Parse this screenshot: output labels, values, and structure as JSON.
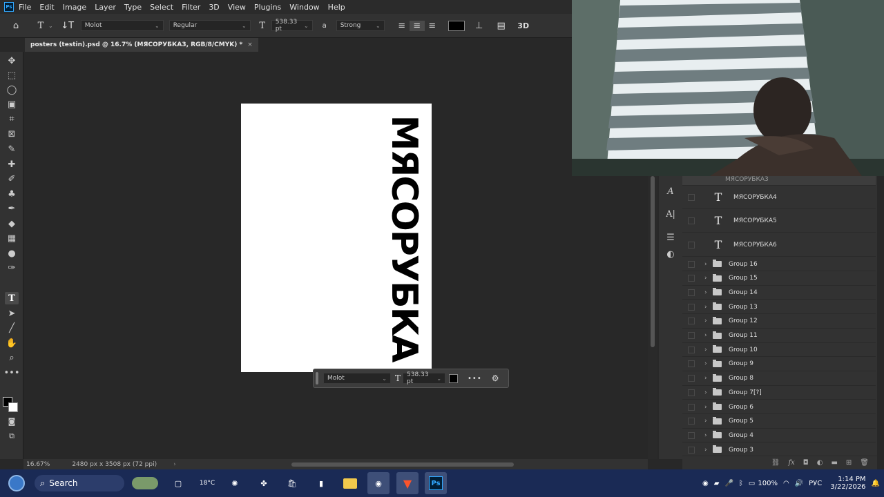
{
  "menubar": {
    "logo": "Ps",
    "items": [
      "File",
      "Edit",
      "Image",
      "Layer",
      "Type",
      "Select",
      "Filter",
      "3D",
      "View",
      "Plugins",
      "Window",
      "Help"
    ]
  },
  "options": {
    "font_family": "Molot",
    "font_style": "Regular",
    "font_size": "538.33 pt",
    "antialias_icon_label": "a",
    "antialias": "Strong",
    "threed_label": "3D",
    "text_color": "#000000"
  },
  "document": {
    "tab_title": "posters (testin).psd @ 16.7% (МЯСОРУБКА3, RGB/8/CMYK) *",
    "close": "×",
    "canvas_text": "МЯСОРУБКА"
  },
  "context_bar": {
    "font_family": "Molot",
    "font_size": "538.33 pt",
    "more": "•••"
  },
  "status": {
    "zoom": "16.67%",
    "dimensions": "2480 px x 3508 px (72 ppi)",
    "chevron": "›"
  },
  "layers": {
    "partial_top": "МЯСОРУБКА3",
    "text_layers": [
      "МЯСОРУБКА4",
      "МЯСОРУБКА5",
      "МЯСОРУБКА6"
    ],
    "groups": [
      "Group 16",
      "Group 15",
      "Group 14",
      "Group 13",
      "Group 12",
      "Group 11",
      "Group 10",
      "Group 9",
      "Group 8",
      "Group 7[?]",
      "Group 6",
      "Group 5",
      "Group 4",
      "Group 3"
    ],
    "text_icon": "T"
  },
  "taskbar": {
    "search": "Search",
    "weather": "18°C",
    "ps_label": "Ps",
    "battery": "100%",
    "lang": "РУС",
    "time": "1:14 PM",
    "date": "3/22/2026"
  },
  "colors": {
    "accent": "#31a8ff",
    "canvas_bg": "#282828",
    "panel_bg": "#323232"
  }
}
